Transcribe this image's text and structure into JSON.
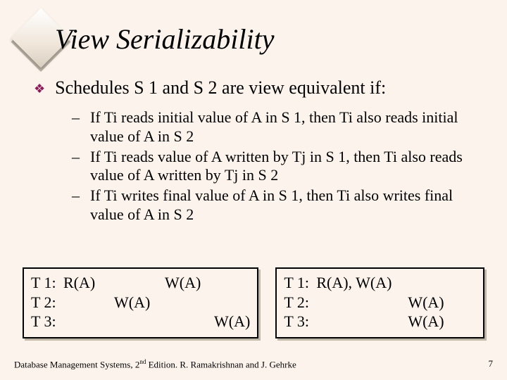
{
  "title": "View Serializability",
  "lvl1": {
    "pre": "Schedules S 1 and S 2 are ",
    "em": "view equivalent",
    "post": " if:"
  },
  "lvl2": [
    "If Ti reads initial value of A in S 1, then Ti also reads initial value of A in S 2",
    "If Ti reads value of A written by Tj in S 1, then Ti also reads value of A written by Tj in S 2",
    "If Ti writes final value of A in S 1, then Ti also writes final value of A in S 2"
  ],
  "box1": {
    "r1": {
      "t": "T 1:",
      "c1": "R(A)",
      "c2": "",
      "c3": "W(A)",
      "c4": ""
    },
    "r2": {
      "t": "T 2:",
      "c1": "",
      "c2": "W(A)",
      "c3": "",
      "c4": ""
    },
    "r3": {
      "t": "T 3:",
      "c1": "",
      "c2": "",
      "c3": "",
      "c4": "W(A)"
    }
  },
  "box2": {
    "r1": {
      "t": "T 1:",
      "a": "R(A), W(A)",
      "b": ""
    },
    "r2": {
      "t": "T 2:",
      "a": "",
      "b": "W(A)"
    },
    "r3": {
      "t": "T 3:",
      "a": "",
      "b": "W(A)"
    }
  },
  "footer": {
    "left_pre": "Database Management Systems, 2",
    "left_sup": "nd",
    "left_post": " Edition. R. Ramakrishnan and J. Gehrke",
    "page": "7"
  },
  "colors": {
    "accent": "#8a1a5a",
    "bg": "#fcf4ec"
  }
}
